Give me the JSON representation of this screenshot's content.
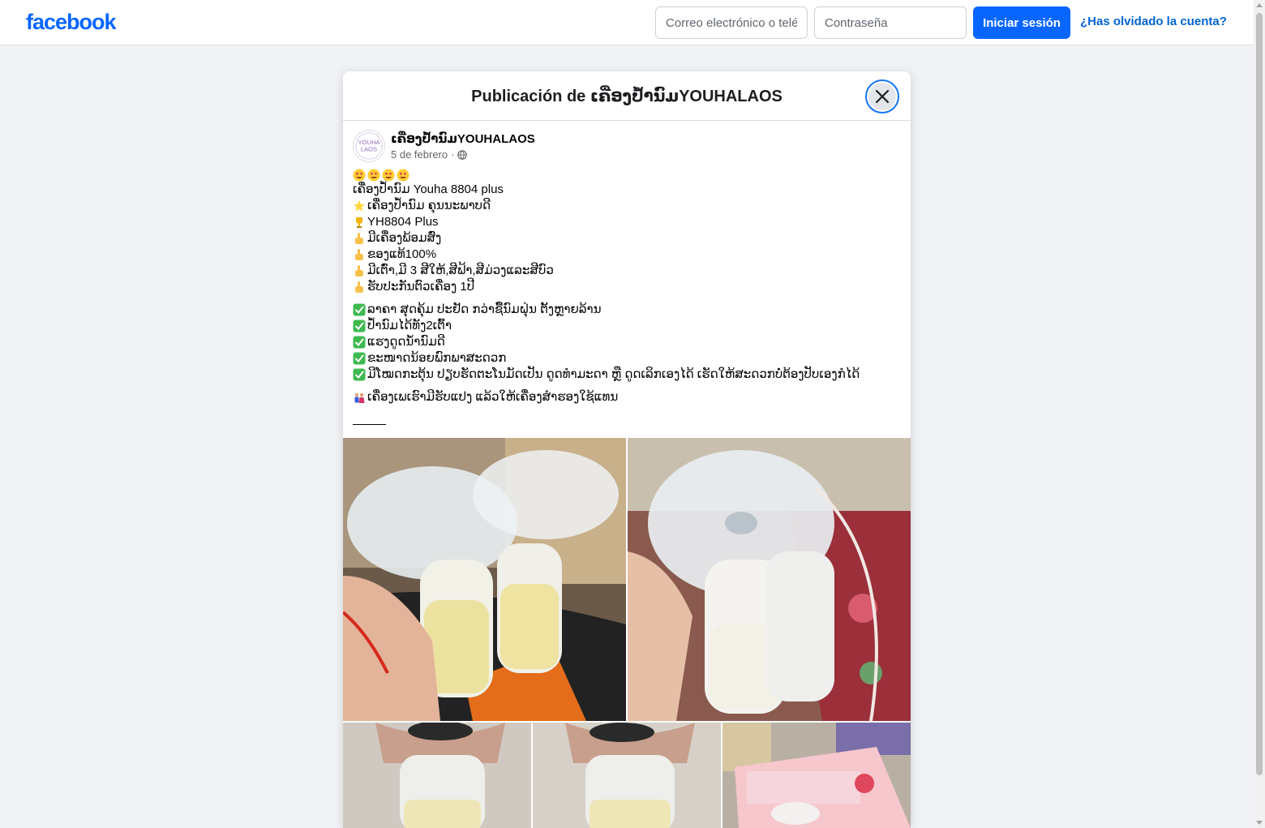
{
  "header": {
    "logo": "facebook",
    "email_placeholder": "Correo electrónico o teléfono",
    "password_placeholder": "Contraseña",
    "login_label": "Iniciar sesión",
    "forgot_label": "¿Has olvidado la cuenta?"
  },
  "modal": {
    "title": "Publicación de ເຄື່ອງປໍ້ານົມYOUHALAOS",
    "close_icon": "close-icon"
  },
  "post": {
    "page_name": "ເຄື່ອງປໍ້ານົມYOUHALAOS",
    "avatar_text": "YOUHA LAOS",
    "date": "5 de febrero",
    "separator": "·",
    "privacy_icon": "globe-icon",
    "lines_block1": [
      {
        "icon": "heart-eyes",
        "text": ""
      },
      {
        "icon": "",
        "text": "ເຄື່ອງປໍ້ານົມ Youha 8804 plus"
      },
      {
        "icon": "star",
        "text": "ເຄື່ອງປໍ້ານົມ ຄຸນນະພາບດີ"
      },
      {
        "icon": "trophy",
        "text": "YH8804 Plus"
      },
      {
        "icon": "point",
        "text": "ມີເຄື່ອງພ້ອມສົ່ງ"
      },
      {
        "icon": "point",
        "text": "ຂອງແທ້100%"
      },
      {
        "icon": "point",
        "text": "ມີເຕົ່າ,ມີ 3 ສີໃຫ້,ສີຟ້າ,ສີມ່ວງແລະສີບົວ"
      },
      {
        "icon": "point",
        "text": "ຮັບປະກັນຕົວເຄື່ອງ 1ປີ"
      }
    ],
    "lines_block2": [
      {
        "icon": "check",
        "text": "ລາຄາ ສຸດຄຸ້ມ ປະຢັດ ກວ່າຊື້ນົມຝຸ່ນ ຕັ້ງຫຼາຍລ້ານ"
      },
      {
        "icon": "check",
        "text": "ປໍ້ານົມໄດ້ທັງ2ເຕົ້າ"
      },
      {
        "icon": "check",
        "text": "ແຮງດູດນ້ຳນົມດີ"
      },
      {
        "icon": "check",
        "text": "ຂະໜາດນ້ອຍພົກພາສະດວກ"
      },
      {
        "icon": "check",
        "text": "ມີໂໝດກະຕຸ້ນ ປຽບຮັດຕະໂນມັດເປັນ ດູດທຳມະດາ ຫຼື ດູດເລິກເອງໄດ້ ເຮັດໃຫ້ສະດວກບໍ່ຕ້ອງປັບເອງກໍໄດ້"
      }
    ],
    "lines_block3": [
      {
        "icon": "family",
        "text": "ເຄື່ອງເພເຮົາມີຮັບແປງ ແລ້ວໃຫ້ເຄື່ອງສຳຮອງໃຊ້ແທນ"
      }
    ]
  },
  "colors": {
    "brand": "#0866ff",
    "link": "#0064d1",
    "background": "#f0f2f5"
  }
}
